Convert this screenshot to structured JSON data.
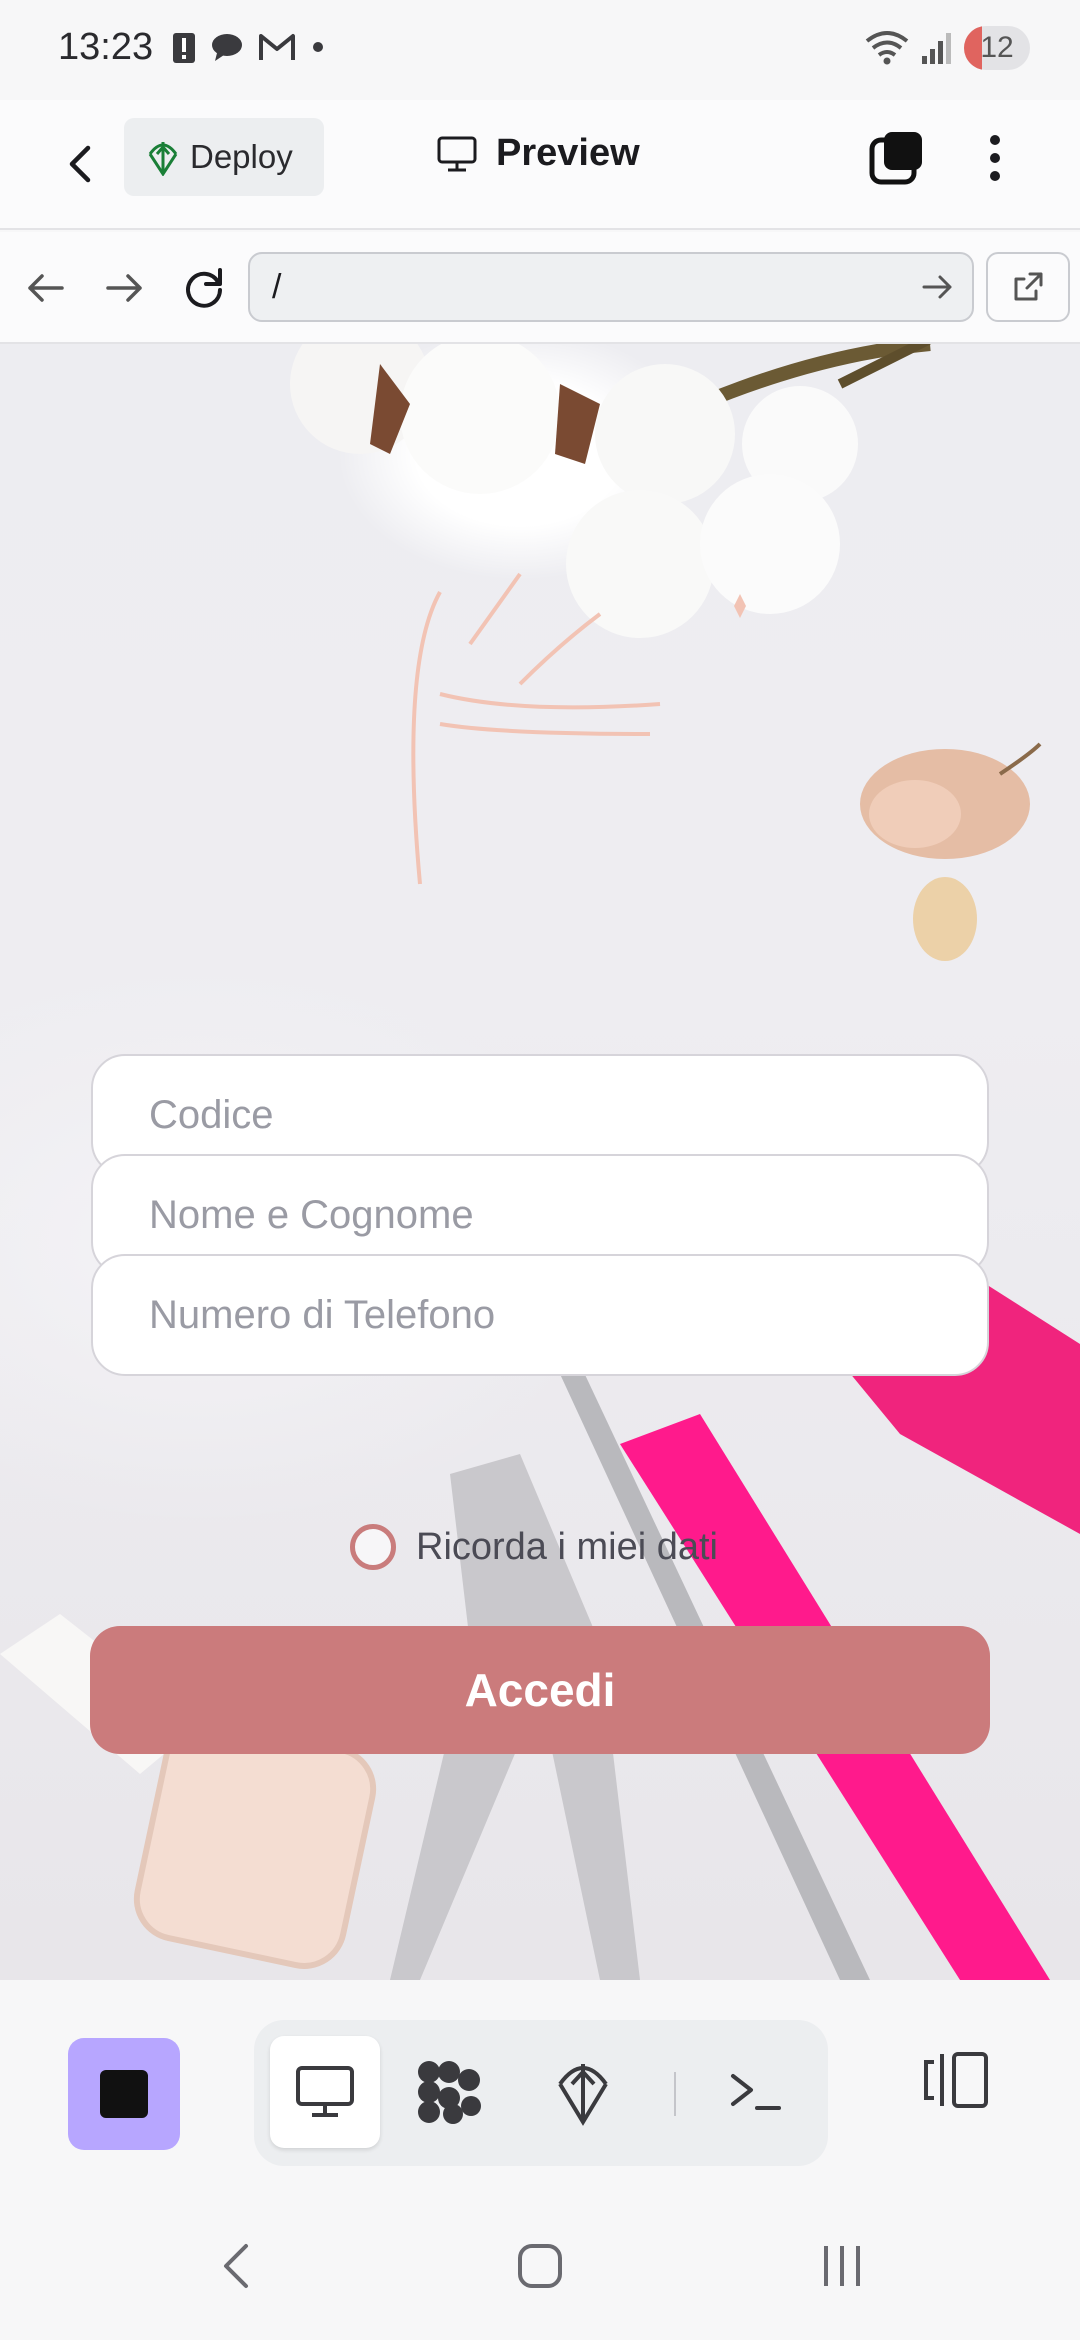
{
  "status_bar": {
    "time": "13:23",
    "left_icons": [
      "alert-icon",
      "chat-icon",
      "gmail-icon",
      "dot-icon"
    ],
    "right_icons": [
      "wifi-icon",
      "signal-icon"
    ],
    "battery": "12"
  },
  "app_bar": {
    "deploy_label": "Deploy",
    "title": "Preview"
  },
  "browser": {
    "url": "/"
  },
  "page": {
    "fields": [
      {
        "placeholder": "Codice"
      },
      {
        "placeholder": "Nome e Cognome"
      },
      {
        "placeholder": "Numero di Telefono"
      }
    ],
    "remember_label": "Ricorda i miei dati",
    "submit_label": "Accedi"
  },
  "dock": {
    "tools": [
      "preview-icon",
      "workflow-icon",
      "deploy-icon",
      "shell-icon"
    ],
    "accent": "#b7a6ff"
  },
  "colors": {
    "primary_button": "#cb7b7c"
  }
}
